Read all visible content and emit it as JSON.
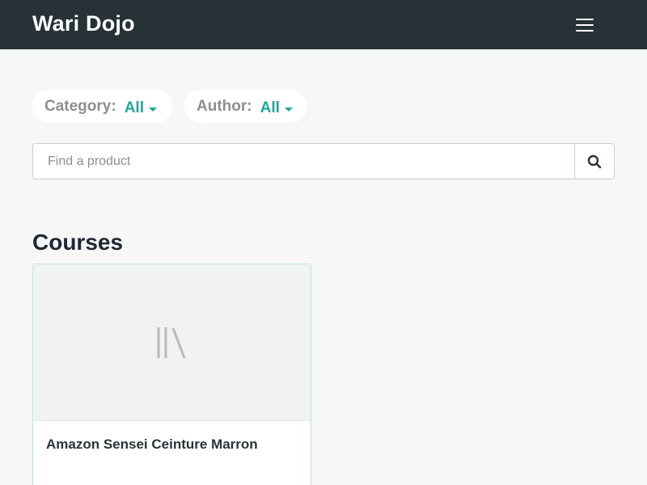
{
  "header": {
    "brand": "Wari Dojo",
    "menu_icon": "hamburger-menu-icon"
  },
  "filters": {
    "category": {
      "label": "Category:",
      "value": "All"
    },
    "author": {
      "label": "Author:",
      "value": "All"
    }
  },
  "search": {
    "placeholder": "Find a product",
    "value": "",
    "icon": "search-icon"
  },
  "courses": {
    "title": "Courses",
    "items": [
      {
        "title": "Amazon Sensei Ceinture Marron",
        "image_icon": "library-books-icon"
      }
    ]
  },
  "colors": {
    "header_bg": "#263235",
    "accent": "#22a699",
    "page_bg": "#f7f7f7"
  }
}
